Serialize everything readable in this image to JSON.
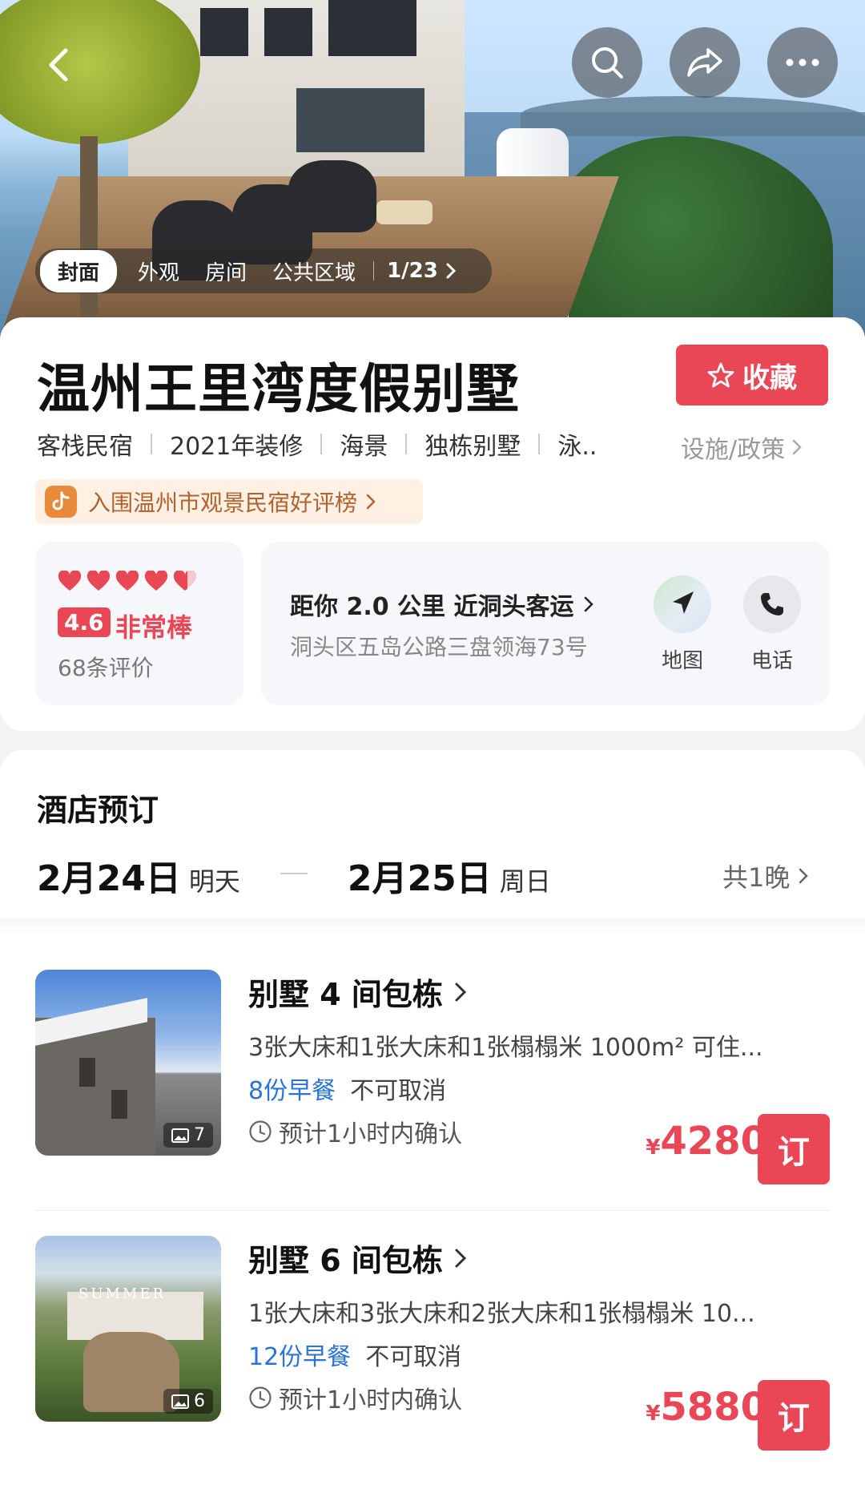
{
  "gallery": {
    "tabs": [
      "封面",
      "外观",
      "房间",
      "公共区域"
    ],
    "counter": "1/23"
  },
  "hotel": {
    "name": "温州王里湾度假别墅",
    "favorite_label": "收藏",
    "tags": [
      "客栈民宿",
      "2021年装修",
      "海景",
      "独栋别墅",
      "泳.."
    ],
    "policy_label": "设施/政策",
    "rank_badge": "入围温州市观景民宿好评榜"
  },
  "rating": {
    "hearts": 5,
    "score": "4.6",
    "label": "非常棒",
    "reviews": "68条评价"
  },
  "location": {
    "distance": "距你 2.0 公里 近洞头客运",
    "address": "洞头区五岛公路三盘领海73号",
    "map_label": "地图",
    "phone_label": "电话"
  },
  "booking": {
    "section_title": "酒店预订",
    "checkin_date": "2月24日",
    "checkin_day": "明天",
    "checkout_date": "2月25日",
    "checkout_day": "周日",
    "nights": "共1晚"
  },
  "rooms": [
    {
      "name": "别墅 4 间包栋",
      "desc": "3张大床和1张大床和1张榻榻米  1000m²  可住...",
      "meal": "8份早餐",
      "cancel": "不可取消",
      "confirm": "预计1小时内确认",
      "currency": "¥",
      "price": "4280",
      "photos": "7",
      "book_label": "订"
    },
    {
      "name": "别墅 6 间包栋",
      "desc": "1张大床和3张大床和2张大床和1张榻榻米  10...",
      "meal": "12份早餐",
      "cancel": "不可取消",
      "confirm": "预计1小时内确认",
      "currency": "¥",
      "price": "5880",
      "photos": "6",
      "book_label": "订",
      "thumb_text": "SUMMER"
    }
  ],
  "colors": {
    "accent": "#e94656",
    "meal_blue": "#2a73d9",
    "badge_text": "#b2622e"
  }
}
